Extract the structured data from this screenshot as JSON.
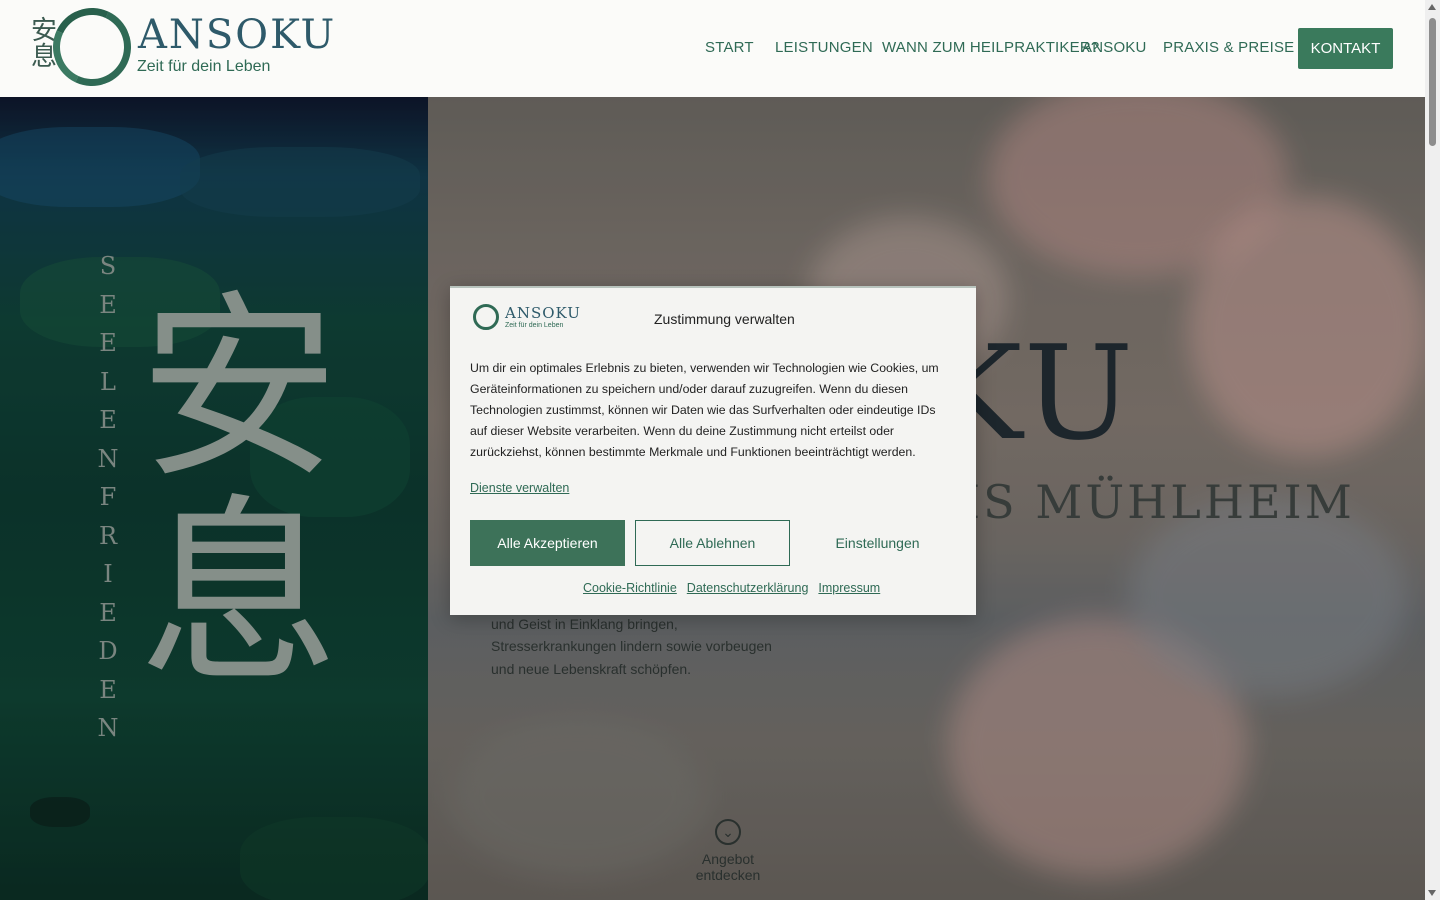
{
  "brand": {
    "name": "ANSOKU",
    "tagline": "Zeit für dein Leben",
    "kanji": "安息",
    "primary_color": "#3a7a5c"
  },
  "nav": {
    "items": [
      "START",
      "LEISTUNGEN",
      "WANN ZUM HEILPRAKTIKER?",
      "ANSOKU",
      "PRAXIS & PREISE"
    ],
    "contact": "KONTAKT"
  },
  "hero": {
    "vertical_text": "SEELENFRIEDEN",
    "big_kanji": "安息",
    "title": "ANSOKU",
    "subtitle": "NATURHEILPRAXIS MÜHLHEIM",
    "paragraph_tail": "genau darum geht es in meiner Praxis: Körper und Geist in Einklang bringen, Stresserkrankungen lindern sowie vorbeugen und neue Lebenskraft schöpfen.",
    "discover_label": "Angebot entdecken"
  },
  "consent": {
    "logo_word": "ANSOKU",
    "logo_tag": "Zeit für dein Leben",
    "title": "Zustimmung verwalten",
    "text": "Um dir ein optimales Erlebnis zu bieten, verwenden wir Technologien wie Cookies, um Geräteinformationen zu speichern und/oder darauf zuzugreifen. Wenn du diesen Technologien zustimmst, können wir Daten wie das Surfverhalten oder eindeutige IDs auf dieser Website verarbeiten. Wenn du deine Zustimmung nicht erteilst oder zurückziehst, können bestimmte Merkmale und Funktionen beeinträchtigt werden.",
    "manage_services": "Dienste verwalten",
    "accept_all": "Alle Akzeptieren",
    "deny_all": "Alle Ablehnen",
    "settings": "Einstellungen",
    "footer_links": [
      "Cookie-Richtlinie",
      "Datenschutzerklärung",
      "Impressum"
    ]
  }
}
